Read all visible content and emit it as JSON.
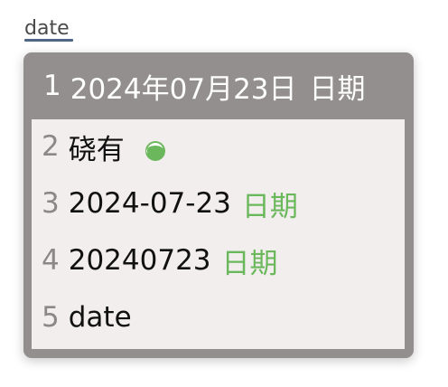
{
  "input": {
    "composition_text": "date"
  },
  "candidates": {
    "highlighted": {
      "index": "1",
      "text": "2024年07月23日",
      "comment": "日期"
    },
    "items": [
      {
        "index": "2",
        "text": "硗有",
        "comment": "",
        "icon": "half-moon-icon"
      },
      {
        "index": "3",
        "text": "2024-07-23",
        "comment": "日期"
      },
      {
        "index": "4",
        "text": "20240723",
        "comment": "日期"
      },
      {
        "index": "5",
        "text": "date",
        "comment": ""
      }
    ]
  },
  "colors": {
    "panel_background": "#928f8e",
    "list_background": "#f2eeee",
    "comment_green": "#6bb85c",
    "index_gray": "#8a8888",
    "underline_blue": "#4f6584"
  }
}
